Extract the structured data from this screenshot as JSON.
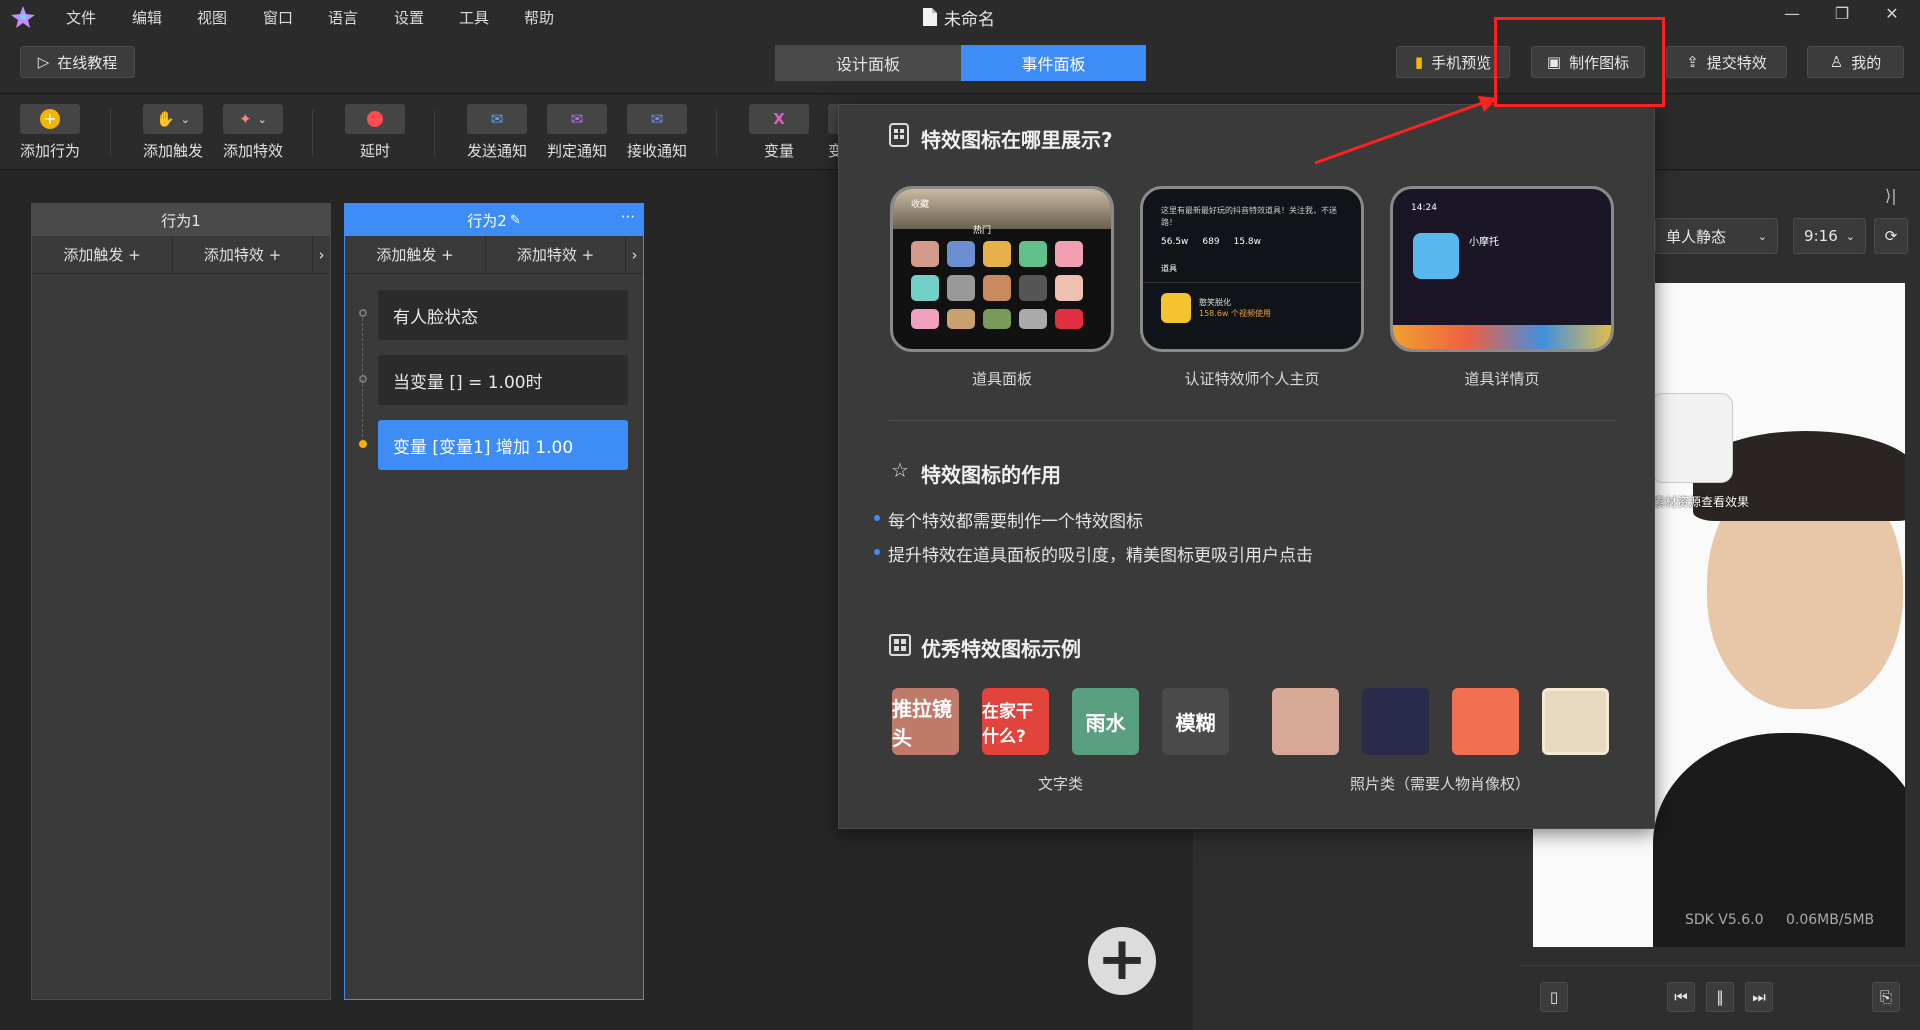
{
  "menubar": {
    "items": [
      "文件",
      "编辑",
      "视图",
      "窗口",
      "语言",
      "设置",
      "工具",
      "帮助"
    ],
    "title": "未命名"
  },
  "toolbar": {
    "tutorial": "在线教程",
    "design_tab": "设计面板",
    "event_tab": "事件面板",
    "phone_preview": "手机预览",
    "make_icon": "制作图标",
    "submit": "提交特效",
    "mine": "我的"
  },
  "tools": [
    {
      "label": "添加行为",
      "icon": "add-behavior-icon"
    },
    {
      "label": "添加触发",
      "icon": "hand-icon"
    },
    {
      "label": "添加特效",
      "icon": "magic-icon"
    },
    {
      "label": "延时",
      "icon": "timer-icon"
    },
    {
      "label": "发送通知",
      "icon": "send-mail-icon"
    },
    {
      "label": "判定通知",
      "icon": "judge-mail-icon"
    },
    {
      "label": "接收通知",
      "icon": "receive-mail-icon"
    },
    {
      "label": "变量",
      "icon": "variable-icon"
    },
    {
      "label": "变"
    }
  ],
  "behavior1": {
    "title": "行为1",
    "add_trigger": "添加触发 +",
    "add_effect": "添加特效 +"
  },
  "behavior2": {
    "title": "行为2",
    "add_trigger": "添加触发 +",
    "add_effect": "添加特效 +",
    "more": "···",
    "nodes": [
      "有人脸状态",
      "当变量 [] = 1.00时",
      "变量 [变量1] 增加 1.00"
    ]
  },
  "popup": {
    "where_title": "特效图标在哪里展示?",
    "shots": [
      {
        "label": "道具面板"
      },
      {
        "label": "认证特效师个人主页"
      },
      {
        "label": "道具详情页"
      }
    ],
    "shot2": {
      "line1": "这里有最新最好玩的抖音特效道具！关注我，不迷路！",
      "stat1": "56.5w",
      "stat2": "689",
      "stat3": "15.8w",
      "tab": "道具",
      "item": "憨笑脱化",
      "item_sub": "158.6w 个视频使用"
    },
    "shot3": {
      "time": "14:24",
      "name": "小摩托"
    },
    "shot1": {
      "tab": "热门",
      "fav": "收藏"
    },
    "role_title": "特效图标的作用",
    "bullets": [
      "每个特效都需要制作一个特效图标",
      "提升特效在道具面板的吸引度，精美图标更吸引用户点击"
    ],
    "examples_title": "优秀特效图标示例",
    "text_examples": [
      "推拉镜头",
      "在家干什么?",
      "雨水",
      "模糊"
    ],
    "text_category": "文字类",
    "photo_category": "照片类（需要人物肖像权）"
  },
  "preview": {
    "mode": "单人静态",
    "ratio": "9:16",
    "sdk": "SDK V5.6.0",
    "mem": "0.06MB/5MB",
    "overlay": "素材资源查看效果"
  }
}
